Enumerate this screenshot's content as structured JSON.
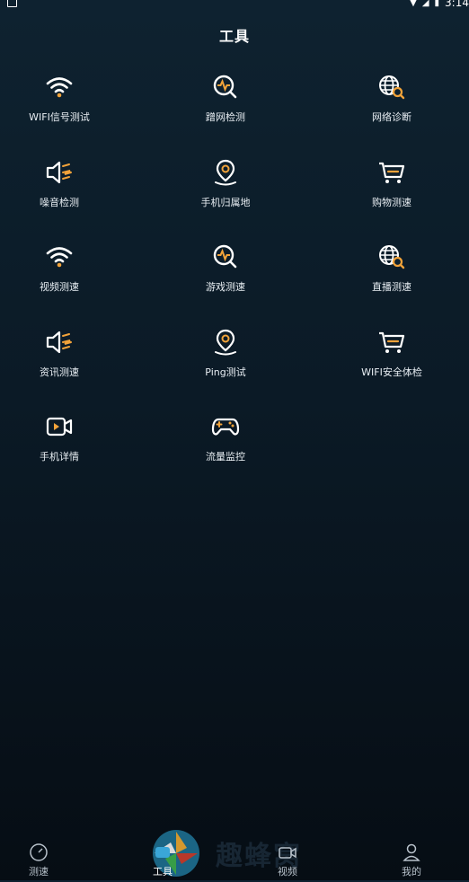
{
  "status_bar": {
    "time": "3:14"
  },
  "header": {
    "title": "工具"
  },
  "tools": [
    {
      "label": "WIFI信号测试",
      "icon": "wifi-icon"
    },
    {
      "label": "蹭网检测",
      "icon": "magnify-pulse-icon"
    },
    {
      "label": "网络诊断",
      "icon": "globe-search-icon"
    },
    {
      "label": "噪音检测",
      "icon": "speaker-noise-icon"
    },
    {
      "label": "手机归属地",
      "icon": "location-pin-icon"
    },
    {
      "label": "购物测速",
      "icon": "cart-icon"
    },
    {
      "label": "视频测速",
      "icon": "wifi-icon"
    },
    {
      "label": "游戏测速",
      "icon": "magnify-pulse-icon"
    },
    {
      "label": "直播测速",
      "icon": "globe-search-icon"
    },
    {
      "label": "资讯测速",
      "icon": "speaker-noise-icon"
    },
    {
      "label": "Ping测试",
      "icon": "location-pin-icon"
    },
    {
      "label": "WIFI安全体检",
      "icon": "cart-icon"
    },
    {
      "label": "手机详情",
      "icon": "video-camera-icon"
    },
    {
      "label": "流量监控",
      "icon": "gamepad-icon"
    }
  ],
  "bottom_nav": [
    {
      "label": "测速",
      "icon": "speedometer-icon"
    },
    {
      "label": "工具",
      "icon": "tools-icon",
      "active": true
    },
    {
      "label": "视频",
      "icon": "video-camera-icon"
    },
    {
      "label": "我的",
      "icon": "user-icon"
    }
  ],
  "watermark": {
    "text": "趣蜂窝"
  },
  "colors": {
    "accent": "#f2a33a",
    "icon_white": "#ffffff",
    "background_top": "#0e2230",
    "background_bottom": "#060d14"
  }
}
